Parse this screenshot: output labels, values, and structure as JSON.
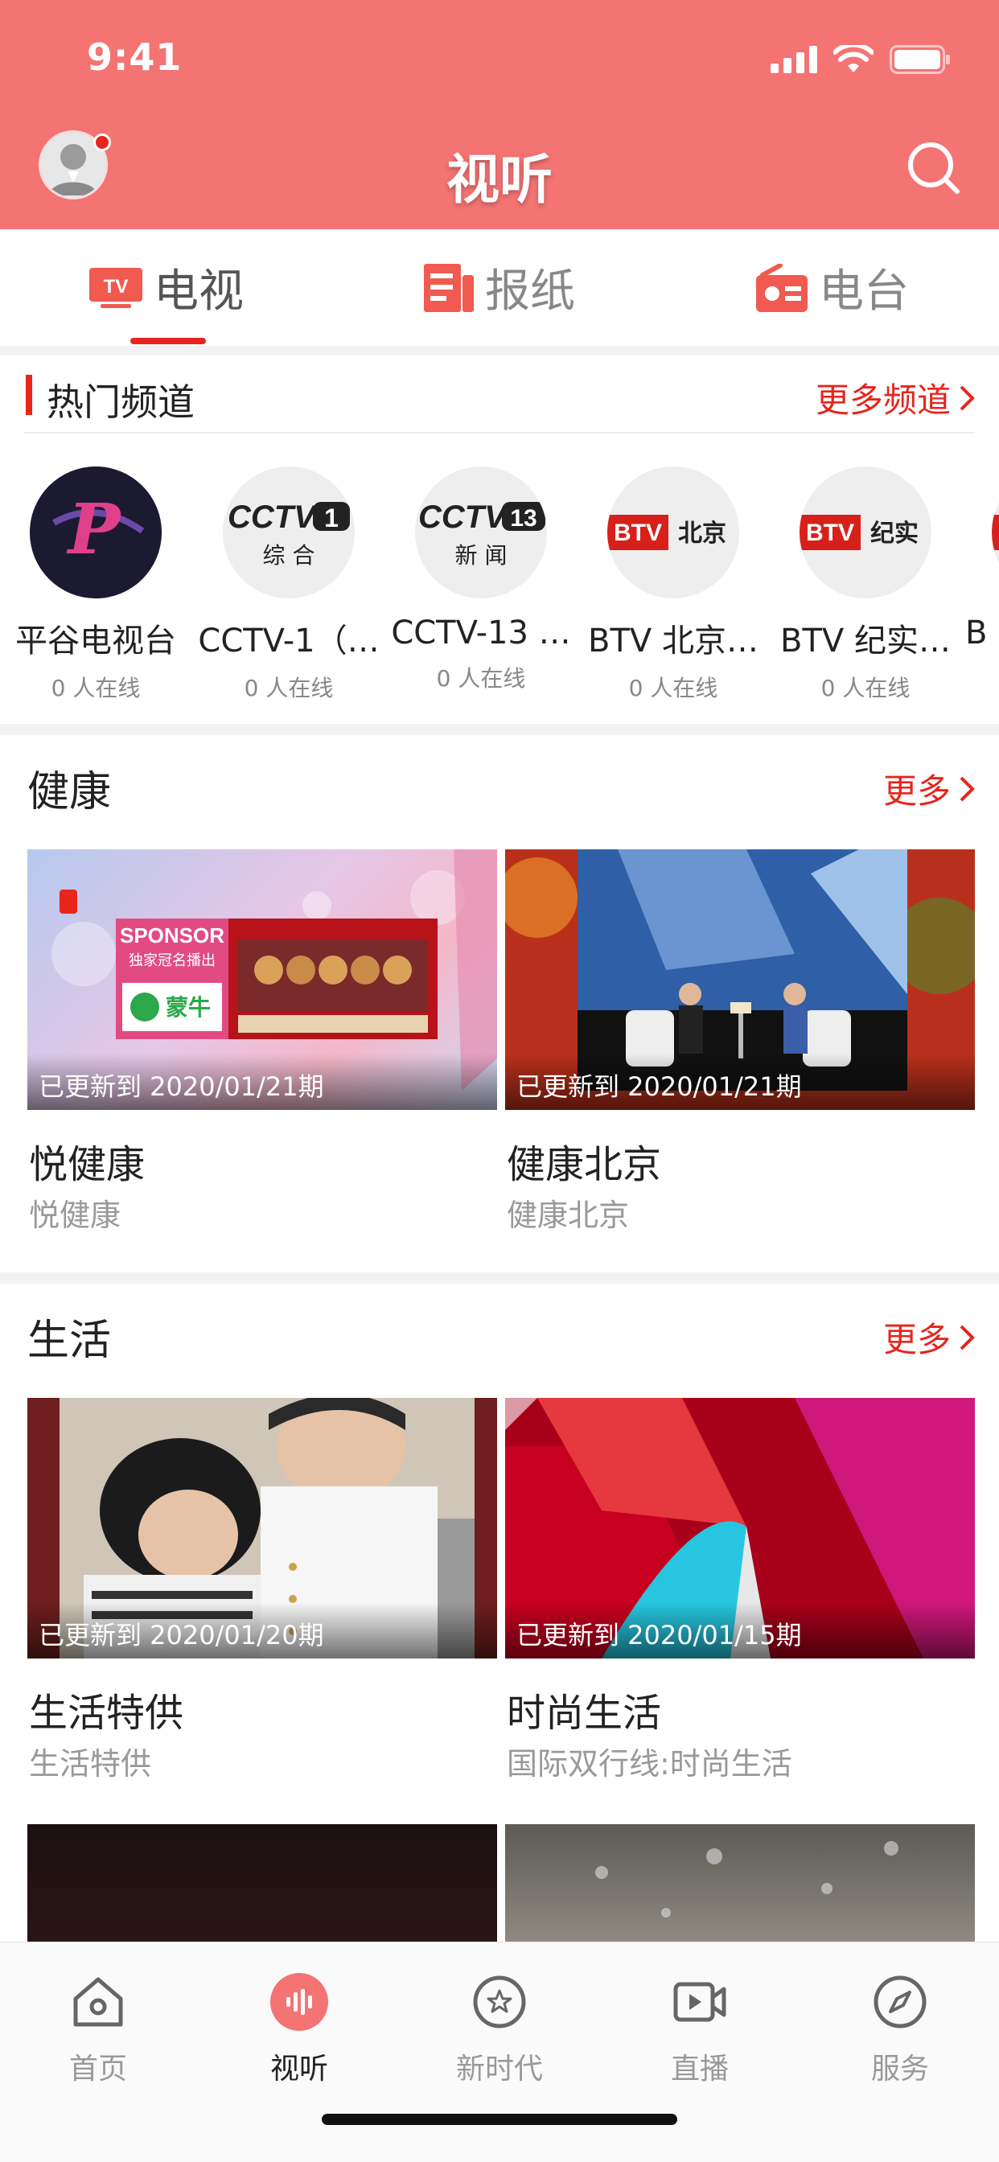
{
  "status": {
    "time": "9:41"
  },
  "nav": {
    "title": "视听"
  },
  "tabs": [
    {
      "label": "电视",
      "icon": "tv-icon",
      "badge": "TV",
      "active": true
    },
    {
      "label": "报纸",
      "icon": "newspaper-icon",
      "active": false
    },
    {
      "label": "电台",
      "icon": "radio-icon",
      "active": false
    }
  ],
  "hot_channels": {
    "title": "热门频道",
    "more": "更多频道",
    "items": [
      {
        "name": "平谷电视台",
        "online": "0 人在线",
        "logo_text": "P"
      },
      {
        "name": "CCTV-1（…",
        "online": "0 人在线",
        "logo_text": "CCTV",
        "logo_num": "1",
        "logo_sub": "综 合"
      },
      {
        "name": "CCTV-13 …",
        "online": "0 人在线",
        "logo_text": "CCTV",
        "logo_num": "13",
        "logo_sub": "新 闻"
      },
      {
        "name": "BTV 北京…",
        "online": "0 人在线",
        "logo_text": "BTV",
        "logo_sub": "北京"
      },
      {
        "name": "BTV 纪实…",
        "online": "0 人在线",
        "logo_text": "BTV",
        "logo_sub": "纪实"
      },
      {
        "name": "B",
        "online": "",
        "logo_text": ""
      }
    ]
  },
  "sections": [
    {
      "title": "健康",
      "more": "更多",
      "cards": [
        {
          "caption": "已更新到 2020/01/21期",
          "title": "悦健康",
          "subtitle": "悦健康",
          "thumb_text": {
            "sponsor": "SPONSOR",
            "sponsor_sub": "独家冠名播出",
            "brand": "蒙牛"
          }
        },
        {
          "caption": "已更新到 2020/01/21期",
          "title": "健康北京",
          "subtitle": "健康北京"
        }
      ]
    },
    {
      "title": "生活",
      "more": "更多",
      "cards": [
        {
          "caption": "已更新到 2020/01/20期",
          "title": "生活特供",
          "subtitle": "生活特供"
        },
        {
          "caption": "已更新到 2020/01/15期",
          "title": "时尚生活",
          "subtitle": "国际双行线:时尚生活"
        }
      ]
    }
  ],
  "tabbar": [
    {
      "label": "首页",
      "icon": "home-icon",
      "active": false
    },
    {
      "label": "视听",
      "icon": "audio-wave-icon",
      "active": true
    },
    {
      "label": "新时代",
      "icon": "star-circle-icon",
      "active": false
    },
    {
      "label": "直播",
      "icon": "video-play-icon",
      "active": false
    },
    {
      "label": "服务",
      "icon": "compass-icon",
      "active": false
    }
  ],
  "colors": {
    "brand": "#f47373",
    "accent": "#e8241c"
  }
}
